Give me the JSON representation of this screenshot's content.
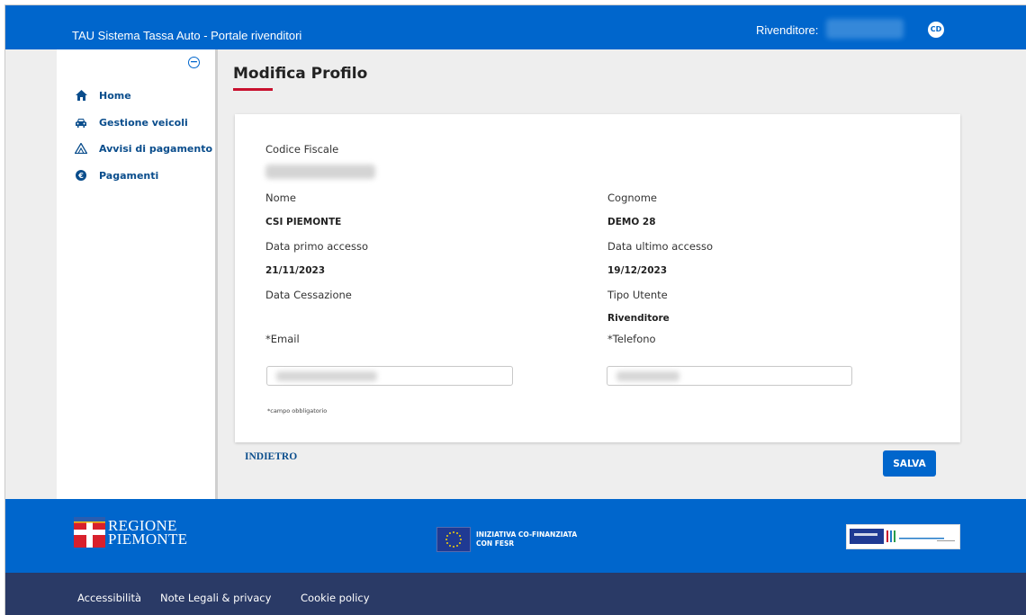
{
  "header": {
    "app_title": "TAU Sistema Tassa Auto - Portale rivenditori",
    "reseller_label": "Rivenditore:",
    "avatar_initials": "CD"
  },
  "sidebar": {
    "items": [
      {
        "label": "Home",
        "icon": "home-icon"
      },
      {
        "label": "Gestione veicoli",
        "icon": "car-icon"
      },
      {
        "label": "Avvisi di pagamento",
        "icon": "warning-icon"
      },
      {
        "label": "Pagamenti",
        "icon": "euro-icon"
      }
    ]
  },
  "page": {
    "title": "Modifica Profilo"
  },
  "profile": {
    "codice_fiscale_label": "Codice Fiscale",
    "nome_label": "Nome",
    "nome_value": "CSI PIEMONTE",
    "cognome_label": "Cognome",
    "cognome_value": "DEMO 28",
    "primo_accesso_label": "Data primo accesso",
    "primo_accesso_value": "21/11/2023",
    "ultimo_accesso_label": "Data ultimo accesso",
    "ultimo_accesso_value": "19/12/2023",
    "cessazione_label": "Data Cessazione",
    "tipo_utente_label": "Tipo Utente",
    "tipo_utente_value": "Rivenditore",
    "email_label": "*Email",
    "telefono_label": "*Telefono",
    "required_note": "*campo obbligatorio"
  },
  "actions": {
    "back_label": "INDIETRO",
    "save_label": "SALVA"
  },
  "footer": {
    "regione_line1": "REGIONE",
    "regione_line2": "PIEMONTE",
    "eu_line1": "INIZIATIVA CO-FINANZIATA",
    "eu_line2": "CON FESR",
    "links": [
      "Accessibilità",
      "Note Legali & privacy",
      "Cookie policy"
    ]
  },
  "colors": {
    "primary": "#0066cc",
    "footer_dark": "#2a3a66",
    "accent_red": "#c8102e",
    "nav_text": "#0a4d8c"
  }
}
